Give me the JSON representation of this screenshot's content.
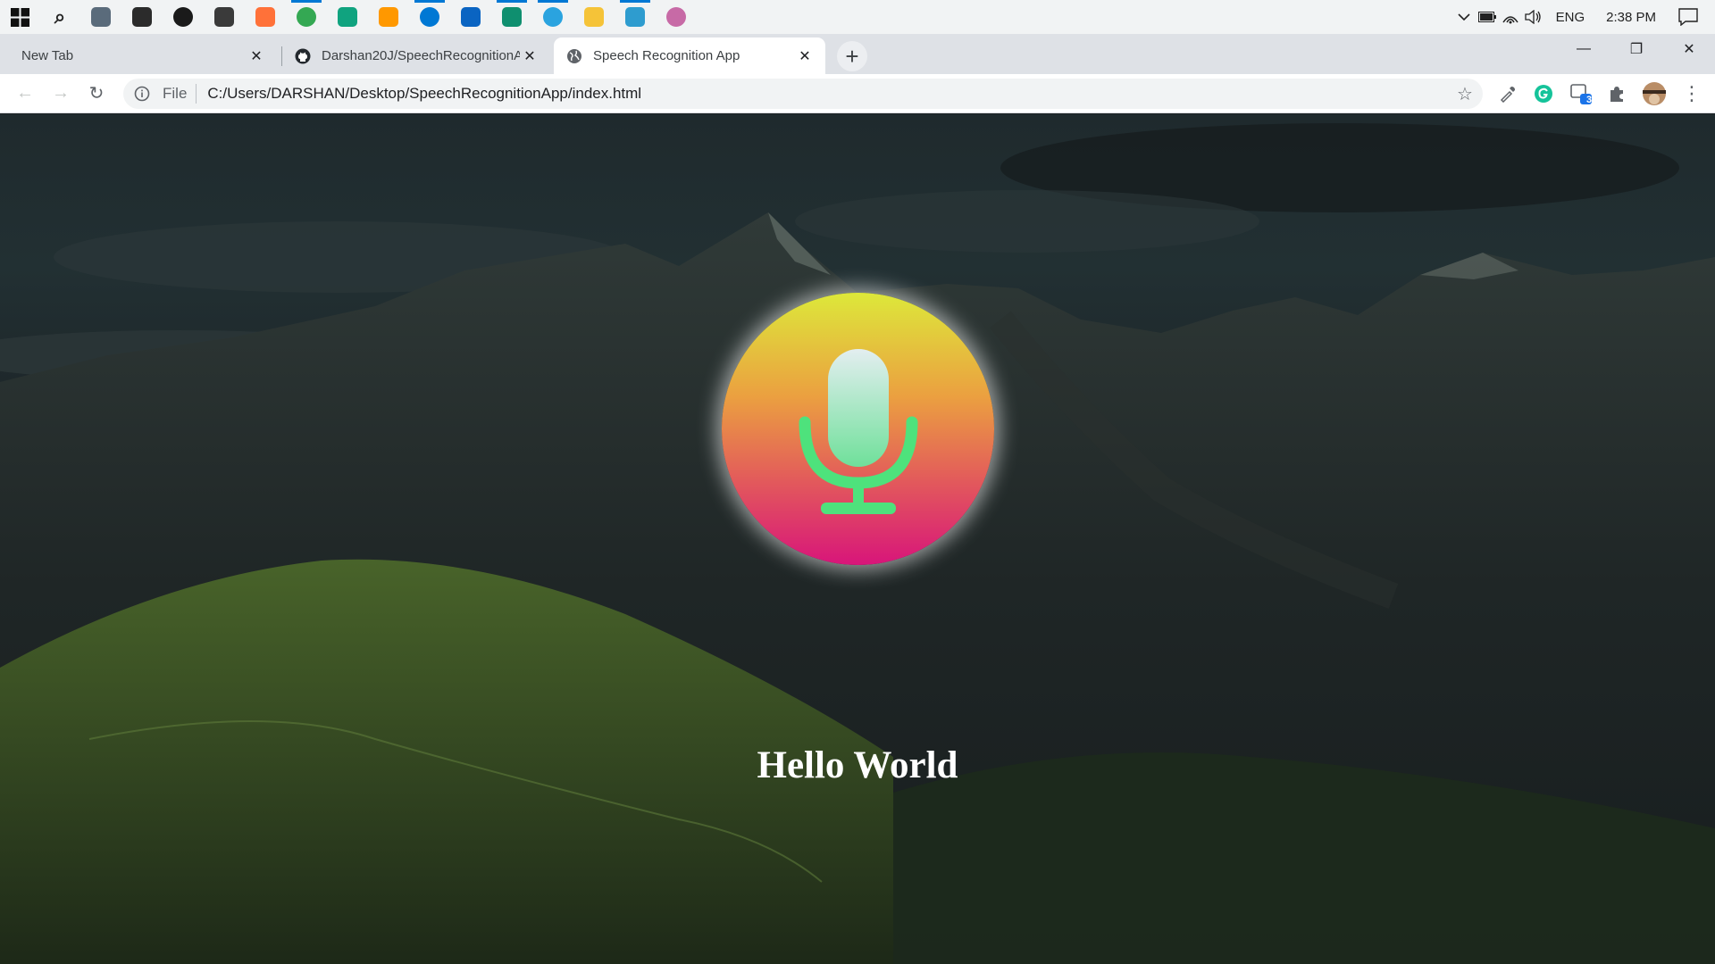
{
  "taskbar": {
    "apps": [
      {
        "name": "search-icon",
        "color": "#222222"
      },
      {
        "name": "calculator-icon",
        "color": "#5a6b7b"
      },
      {
        "name": "obs-icon",
        "color": "#2b2b2b"
      },
      {
        "name": "media-player-icon",
        "color": "#1a1a1a"
      },
      {
        "name": "davinci-icon",
        "color": "#3a3a3a"
      },
      {
        "name": "firefox-icon",
        "color": "#ff7139"
      },
      {
        "name": "chrome-icon",
        "color": "#34a853"
      },
      {
        "name": "chatgpt-icon",
        "color": "#10a37f"
      },
      {
        "name": "sublime-icon",
        "color": "#ff9800"
      },
      {
        "name": "vscode-icon",
        "color": "#0078d4"
      },
      {
        "name": "mail-icon",
        "color": "#0a64c2"
      },
      {
        "name": "whatsapp-icon",
        "color": "#0f8f6f"
      },
      {
        "name": "telegram-icon",
        "color": "#2aa3df"
      },
      {
        "name": "file-explorer-icon",
        "color": "#f5c338"
      },
      {
        "name": "electron-icon",
        "color": "#2e9ccf"
      },
      {
        "name": "git-icon",
        "color": "#c76aa6"
      }
    ],
    "language": "ENG",
    "time": "2:38 PM"
  },
  "tabs": [
    {
      "title": "New Tab",
      "close": "✕"
    },
    {
      "title": "Darshan20J/SpeechRecognitionA",
      "close": "✕"
    },
    {
      "title": "Speech Recognition App",
      "close": "✕"
    }
  ],
  "newtab_label": "+",
  "window_controls": {
    "minimize": "—",
    "restore": "❐",
    "close": "✕"
  },
  "toolbar": {
    "back": "←",
    "forward": "→",
    "reload": "↻",
    "scheme_label": "File",
    "url": "C:/Users/DARSHAN/Desktop/SpeechRecognitionApp/index.html",
    "star": "☆",
    "extension_badge": "3",
    "menu": "⋮"
  },
  "page": {
    "result_text": "Hello World",
    "mic_gradient": [
      "#dde83a",
      "#eba040",
      "#e2585c",
      "#d8157a"
    ],
    "mic_icon_color": "#4ee27c"
  }
}
